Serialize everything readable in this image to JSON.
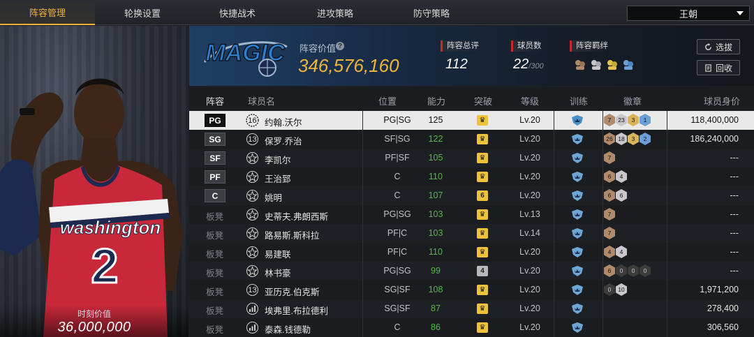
{
  "tabs": [
    {
      "label": "阵容管理",
      "active": true
    },
    {
      "label": "轮换设置",
      "active": false
    },
    {
      "label": "快捷战术",
      "active": false
    },
    {
      "label": "进攻策略",
      "active": false
    },
    {
      "label": "防守策略",
      "active": false
    }
  ],
  "team_select": {
    "value": "王朝"
  },
  "player_card": {
    "value_label": "时刻价值",
    "value": "36,000,000",
    "jersey_text": "washington",
    "jersey_number": "2"
  },
  "team_header": {
    "logo_text": "MAGIC",
    "lineup_value_label": "阵容价值",
    "lineup_value": "346,576,160",
    "overall_label": "阵容总评",
    "overall_value": "112",
    "player_count_label": "球员数",
    "player_count_value": "22",
    "player_count_max": "/300",
    "combo_label": "阵容羁绊",
    "pick_button": "选拔",
    "recycle_button": "回收",
    "accent_color": "#f0b33c"
  },
  "table": {
    "headers": {
      "lineup": "阵容",
      "player": "球员名",
      "position": "位置",
      "ability": "能力",
      "breakthrough": "突破",
      "level": "等级",
      "training": "训练",
      "badges": "徽章",
      "salary": "球员身价"
    },
    "rows": [
      {
        "slot": "PG",
        "starter": true,
        "number": "16",
        "num_style": "gear",
        "name": "约翰.沃尔",
        "position": "PG|SG",
        "ability": "125",
        "break": "♛",
        "break_style": "gold",
        "level": "Lv.20",
        "badges": [
          {
            "v": "7",
            "c": "bronze"
          },
          {
            "v": "23",
            "c": "silver"
          },
          {
            "v": "3",
            "c": "gold"
          },
          {
            "v": "1",
            "c": "blue"
          }
        ],
        "salary": "118,400,000"
      },
      {
        "slot": "SG",
        "starter": true,
        "number": "13",
        "num_style": "circle",
        "name": "保罗.乔治",
        "position": "SF|SG",
        "ability": "122",
        "break": "♛",
        "break_style": "gold",
        "level": "Lv.20",
        "badges": [
          {
            "v": "26",
            "c": "bronze"
          },
          {
            "v": "18",
            "c": "silver"
          },
          {
            "v": "3",
            "c": "gold"
          },
          {
            "v": "2",
            "c": "blue"
          }
        ],
        "salary": "186,240,000"
      },
      {
        "slot": "SF",
        "starter": true,
        "number": "",
        "num_style": "star",
        "name": "李凯尔",
        "position": "PF|SF",
        "ability": "105",
        "break": "♛",
        "break_style": "gold",
        "level": "Lv.20",
        "badges": [
          {
            "v": "7",
            "c": "bronze"
          }
        ],
        "salary": "---"
      },
      {
        "slot": "PF",
        "starter": true,
        "number": "",
        "num_style": "star",
        "name": "王治郅",
        "position": "C",
        "ability": "110",
        "break": "♛",
        "break_style": "gold",
        "level": "Lv.20",
        "badges": [
          {
            "v": "6",
            "c": "bronze"
          },
          {
            "v": "4",
            "c": "silver"
          }
        ],
        "salary": "---"
      },
      {
        "slot": "C",
        "starter": true,
        "number": "",
        "num_style": "star",
        "name": "姚明",
        "position": "C",
        "ability": "107",
        "break": "6",
        "break_style": "gold",
        "level": "Lv.20",
        "badges": [
          {
            "v": "6",
            "c": "bronze"
          },
          {
            "v": "6",
            "c": "silver"
          }
        ],
        "salary": "---"
      },
      {
        "slot": "板凳",
        "starter": false,
        "number": "",
        "num_style": "star",
        "name": "史蒂夫.弗朗西斯",
        "position": "PG|SG",
        "ability": "103",
        "break": "♛",
        "break_style": "gold",
        "level": "Lv.13",
        "badges": [
          {
            "v": "7",
            "c": "bronze"
          }
        ],
        "salary": "---"
      },
      {
        "slot": "板凳",
        "starter": false,
        "number": "",
        "num_style": "star",
        "name": "路易斯.斯科拉",
        "position": "PF|C",
        "ability": "103",
        "break": "♛",
        "break_style": "gold",
        "level": "Lv.14",
        "badges": [
          {
            "v": "7",
            "c": "bronze"
          }
        ],
        "salary": "---"
      },
      {
        "slot": "板凳",
        "starter": false,
        "number": "",
        "num_style": "star",
        "name": "易建联",
        "position": "PF|C",
        "ability": "110",
        "break": "♛",
        "break_style": "gold",
        "level": "Lv.20",
        "badges": [
          {
            "v": "4",
            "c": "bronze"
          },
          {
            "v": "4",
            "c": "silver"
          }
        ],
        "salary": "---"
      },
      {
        "slot": "板凳",
        "starter": false,
        "number": "",
        "num_style": "star",
        "name": "林书豪",
        "position": "PG|SG",
        "ability": "99",
        "break": "4",
        "break_style": "grey",
        "level": "Lv.20",
        "badges": [
          {
            "v": "6",
            "c": "bronze"
          },
          {
            "v": "0",
            "c": "dark"
          },
          {
            "v": "0",
            "c": "dark"
          },
          {
            "v": "0",
            "c": "dark"
          }
        ],
        "salary": "---"
      },
      {
        "slot": "板凳",
        "starter": false,
        "number": "13",
        "num_style": "circle",
        "name": "亚历克.伯克斯",
        "position": "SG|SF",
        "ability": "108",
        "break": "♛",
        "break_style": "gold",
        "level": "Lv.20",
        "badges": [
          {
            "v": "0",
            "c": "dark"
          },
          {
            "v": "10",
            "c": "silver"
          }
        ],
        "salary": "1,971,200"
      },
      {
        "slot": "板凳",
        "starter": false,
        "number": "",
        "num_style": "bars",
        "name": "埃弗里.布拉德利",
        "position": "SG|SF",
        "ability": "87",
        "break": "♛",
        "break_style": "gold",
        "level": "Lv.20",
        "badges": [],
        "salary": "278,400"
      },
      {
        "slot": "板凳",
        "starter": false,
        "number": "",
        "num_style": "bars",
        "name": "泰森.钱德勒",
        "position": "C",
        "ability": "86",
        "break": "♛",
        "break_style": "gold",
        "level": "Lv.20",
        "badges": [],
        "salary": "306,560"
      }
    ]
  }
}
